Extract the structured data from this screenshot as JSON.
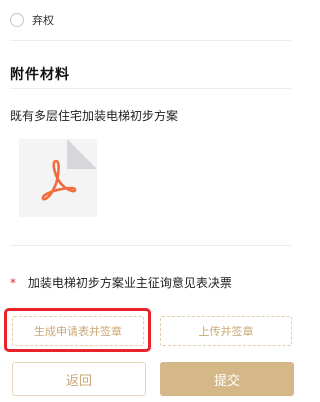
{
  "vote_option": {
    "label": "弃权"
  },
  "attachments": {
    "section_title": "附件材料",
    "doc_title": "既有多层住宅加装电梯初步方案",
    "file_icon": "pdf-file-icon"
  },
  "consent_form": {
    "required_mark": "*",
    "label": "加装电梯初步方案业主征询意见表决票",
    "generate_button": "生成申请表并签章",
    "upload_button": "上传并签章"
  },
  "footer": {
    "back_button": "返回",
    "submit_button": "提交"
  },
  "colors": {
    "accent": "#c9a974",
    "submit_bg": "#d4b887",
    "highlight": "#e8232a",
    "required": "#d9322b"
  }
}
